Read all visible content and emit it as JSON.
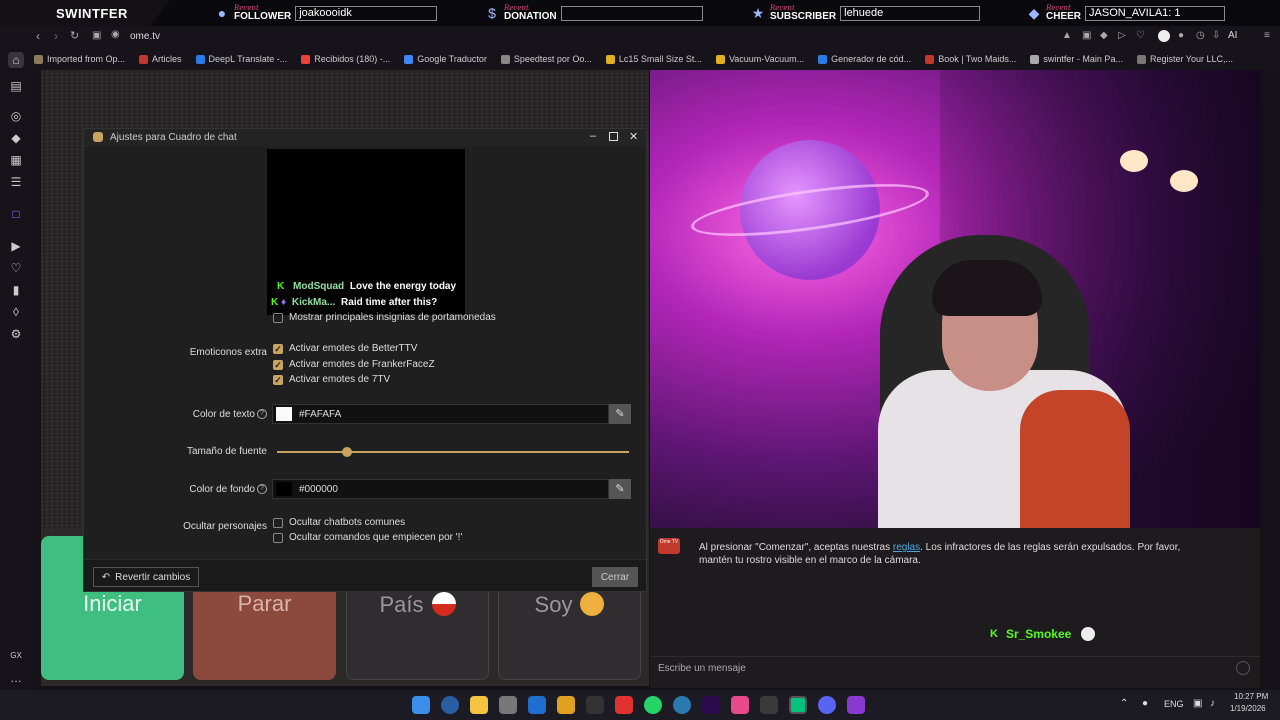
{
  "overlay": {
    "brand": "SWINTFER",
    "recent_label": "Recent",
    "follower_label": "FOLLOWER",
    "follower_value": "joakoooidk",
    "donation_label": "DONATION",
    "donation_value": "",
    "subscriber_label": "SUBSCRIBER",
    "subscriber_value": "lehuede",
    "cheer_label": "CHEER",
    "cheer_value": "JASON_AVILA1: 1"
  },
  "browser": {
    "url": "ome.tv",
    "bookmarks": [
      "Imported from Op...",
      "Articles",
      "DeepL Translate -...",
      "Recibidos (180) -...",
      "Google Traductor",
      "Speedtest por Oo...",
      "Lc15 Small Size St...",
      "Vacuum-Vacuum...",
      "Generador de cód...",
      "Book | Two Maids...",
      "swintfer - Main Pa...",
      "Register Your LLC,..."
    ],
    "sidebar_bottom": "GX",
    "ai_label": "AI"
  },
  "page": {
    "buttons": {
      "start": "Iniciar",
      "stop": "Parar",
      "country": "País",
      "me": "Soy"
    },
    "chat_notice_prefix": "Al presionar \"Comenzar\", aceptas nuestras ",
    "chat_notice_link": "reglas",
    "chat_notice_suffix": ". Los infractores de las reglas serán expulsados. Por favor, mantén tu rostro visible en el marco de la cámara.",
    "chat_username": "Sr_Smokee",
    "message_placeholder": "Escribe un mensaje",
    "logo_text": "Ome TV"
  },
  "dialog": {
    "title": "Ajustes para Cuadro de chat",
    "preview_messages": [
      {
        "user": "ModSquad",
        "text": "Love the energy today"
      },
      {
        "user": "KickMa...",
        "text": "Raid time after this?"
      }
    ],
    "wallet_badges": "Mostrar principales insignias de portamonedas",
    "extra_emotes_label": "Emoticonos extra",
    "emotes": [
      "Activar emotes de BetterTTV",
      "Activar emotes de FrankerFaceZ",
      "Activar emotes de 7TV"
    ],
    "text_color_label": "Color de texto",
    "text_color_value": "#FAFAFA",
    "font_size_label": "Tamaño de fuente",
    "font_size_level": 0.2,
    "bg_color_label": "Color de fondo",
    "bg_color_value": "#000000",
    "hide_label": "Ocultar personajes",
    "hide_options": [
      "Ocultar chatbots comunes",
      "Ocultar comandos que empiecen por '!'"
    ],
    "revert_button": "Revertir cambios",
    "close_button": "Cerrar"
  },
  "taskbar": {
    "lang": "ENG",
    "time": "10:27 PM",
    "date": "1/19/2026"
  },
  "colors": {
    "accent_gold": "#c9a461",
    "start_green": "#3fbf7f",
    "stop_red": "#8c4a3e",
    "kick_green": "#53fc18"
  }
}
